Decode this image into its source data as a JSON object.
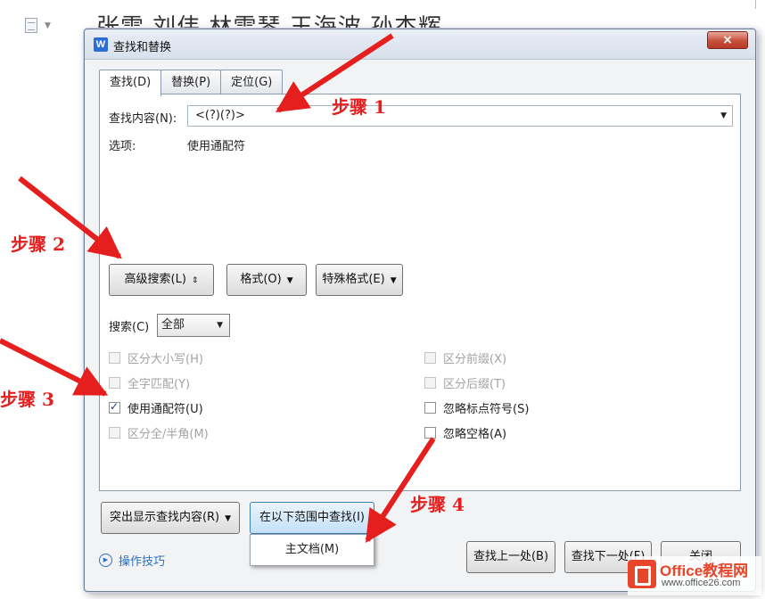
{
  "document": {
    "names_text": "张雪 刘伟 林雪琴 王海波 孙杰辉"
  },
  "dialog": {
    "app_icon_letter": "W",
    "title": "查找和替换",
    "close_label": "×"
  },
  "tabs": [
    {
      "label": "查找(D)",
      "active": true
    },
    {
      "label": "替换(P)",
      "active": false
    },
    {
      "label": "定位(G)",
      "active": false
    }
  ],
  "find": {
    "label": "查找内容(N):",
    "value": "<(?)(?)>",
    "options_label": "选项:",
    "options_value": "使用通配符"
  },
  "buttons": {
    "advanced_search": "高级搜索(L)",
    "advanced_search_icon": "⇕",
    "format": "格式(O)",
    "special_format": "特殊格式(E)",
    "highlight": "突出显示查找内容(R)",
    "find_in_range": "在以下范围中查找(I)",
    "find_prev": "查找上一处(B)",
    "find_next": "查找下一处(F)",
    "close": "关闭"
  },
  "search_scope": {
    "label": "搜索(C)",
    "value": "全部"
  },
  "options_left": [
    {
      "label": "区分大小写(H)",
      "checked": false,
      "enabled": false
    },
    {
      "label": "全字匹配(Y)",
      "checked": false,
      "enabled": false
    },
    {
      "label": "使用通配符(U)",
      "checked": true,
      "enabled": true
    },
    {
      "label": "区分全/半角(M)",
      "checked": false,
      "enabled": false
    }
  ],
  "options_right": [
    {
      "label": "区分前缀(X)",
      "checked": false,
      "enabled": false
    },
    {
      "label": "区分后缀(T)",
      "checked": false,
      "enabled": false
    },
    {
      "label": "忽略标点符号(S)",
      "checked": false,
      "enabled": true
    },
    {
      "label": "忽略空格(A)",
      "checked": false,
      "enabled": true
    }
  ],
  "range_menu": {
    "item": "主文档(M)"
  },
  "tips_label": "操作技巧",
  "annotations": {
    "step1": "步骤 1",
    "step2": "步骤 2",
    "step3": "步骤 3",
    "step4": "步骤 4",
    "color": "#e51e1e"
  },
  "watermark": {
    "title": "Office教程网",
    "url": "www.office26.com"
  }
}
